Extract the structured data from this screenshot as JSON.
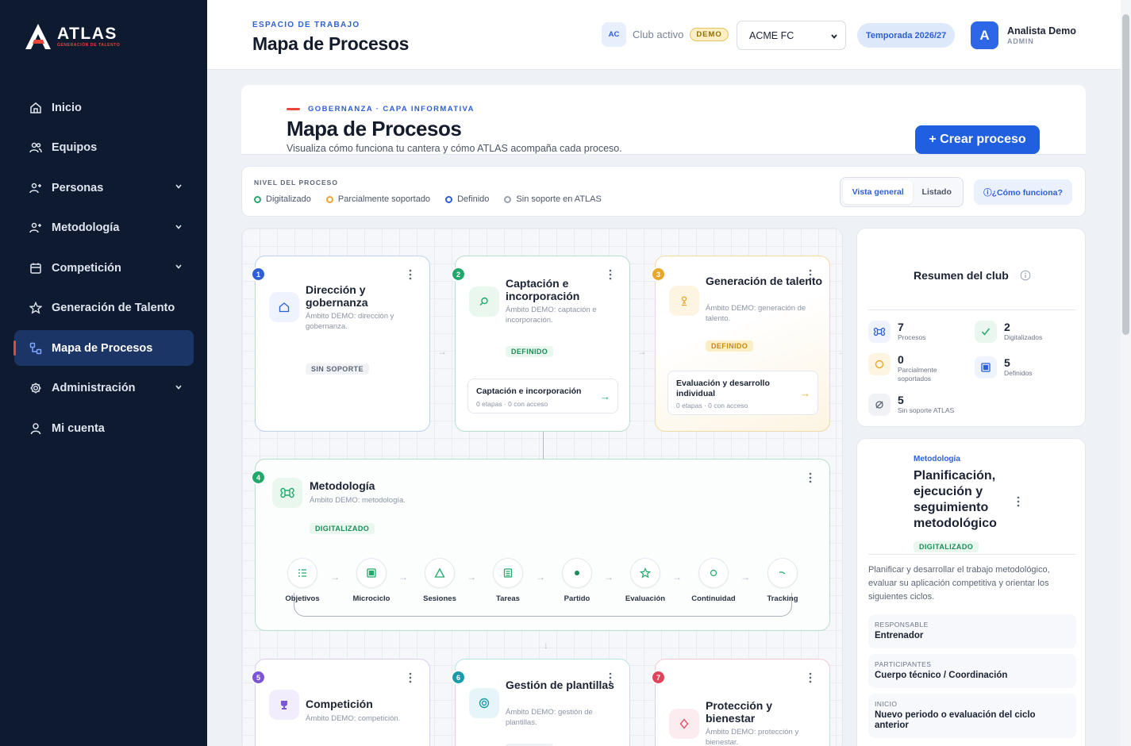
{
  "brand": {
    "name": "ATLAS",
    "tagline": "GENERACIÓN DE TALENTO"
  },
  "sidebar": {
    "items": [
      {
        "label": "Inicio",
        "icon": "home-icon"
      },
      {
        "label": "Equipos",
        "icon": "users-icon"
      },
      {
        "label": "Personas",
        "icon": "user-plus-icon",
        "expandable": true
      },
      {
        "label": "Metodología",
        "icon": "user-plus-icon",
        "expandable": true
      },
      {
        "label": "Competición",
        "icon": "calendar-icon",
        "expandable": true
      },
      {
        "label": "Generación de Talento",
        "icon": "star-icon"
      },
      {
        "label": "Mapa de Procesos",
        "icon": "process-map-icon",
        "active": true
      },
      {
        "label": "Administración",
        "icon": "gear-icon",
        "expandable": true
      },
      {
        "label": "Mi cuenta",
        "icon": "user-icon"
      }
    ]
  },
  "topbar": {
    "workspace_label": "ESPACIO DE TRABAJO",
    "title": "Mapa de Procesos",
    "club_badge": "AC",
    "club_label": "Club activo",
    "demo": "DEMO",
    "club_select": "ACME FC",
    "season": "Temporada 2026/27",
    "avatar": "A",
    "user_name": "Analista Demo",
    "user_role": "ADMIN"
  },
  "header": {
    "label": "GOBERNANZA · CAPA INFORMATIVA",
    "title": "Mapa de Procesos",
    "subtitle": "Visualiza cómo funciona tu cantera y cómo ATLAS acompaña cada proceso.",
    "create_button": "+ Crear proceso"
  },
  "filters": {
    "label": "NIVEL DEL PROCESO",
    "legend": [
      {
        "label": "Digitalizado",
        "color": "#21a86a"
      },
      {
        "label": "Parcialmente soportado",
        "color": "#e8a72c"
      },
      {
        "label": "Definido",
        "color": "#2d5fd6"
      },
      {
        "label": "Sin soporte en ATLAS",
        "color": "#9aa2b1"
      }
    ],
    "view_general": "Vista general",
    "view_list": "Listado",
    "how_button": "ⓘ¿Cómo funciona?"
  },
  "processes": [
    {
      "num": "1",
      "title": "Dirección y gobernanza",
      "desc": "Ámbito DEMO: dirección y gobernanza.",
      "status": "SIN SOPORTE",
      "icon": "home-icon"
    },
    {
      "num": "2",
      "title": "Captación e incorporación",
      "desc": "Ámbito DEMO: captación e incorporación.",
      "status": "DEFINIDO",
      "icon": "search-icon",
      "sub_title": "Captación e incorporación",
      "sub_meta": "0 etapas · 0 con acceso"
    },
    {
      "num": "3",
      "title": "Generación de talento",
      "desc": "Ámbito DEMO: generación de talento.",
      "status": "DEFINIDO",
      "icon": "trophy-icon",
      "sub_title": "Evaluación y desarrollo individual",
      "sub_meta": "0 etapas · 0 con acceso"
    },
    {
      "num": "4",
      "title": "Metodología",
      "desc": "Ámbito DEMO: metodología.",
      "status": "DIGITALIZADO",
      "icon": "command-icon"
    },
    {
      "num": "5",
      "title": "Competición",
      "desc": "Ámbito DEMO: competición.",
      "icon": "trophy-icon"
    },
    {
      "num": "6",
      "title": "Gestión de plantillas",
      "desc": "Ámbito DEMO: gestión de plantillas.",
      "icon": "target-icon"
    },
    {
      "num": "7",
      "title": "Protección y bienestar",
      "desc": "Ámbito DEMO: protección y bienestar.",
      "icon": "shield-icon"
    }
  ],
  "stages": [
    "Objetivos",
    "Microciclo",
    "Sesiones",
    "Tareas",
    "Partido",
    "Evaluación",
    "Continuidad",
    "Tracking"
  ],
  "summary": {
    "title": "Resumen del club",
    "stats": [
      {
        "value": "7",
        "label": "Procesos"
      },
      {
        "value": "2",
        "label": "Digitalizados"
      },
      {
        "value": "0",
        "label": "Parcialmente soportados"
      },
      {
        "value": "5",
        "label": "Definidos"
      },
      {
        "value": "5",
        "label": "Sin soporte ATLAS"
      }
    ]
  },
  "detail": {
    "label": "Metodología",
    "title": "Planificación, ejecución y seguimiento metodológico",
    "status": "DIGITALIZADO",
    "description": "Planificar y desarrollar el trabajo metodológico, evaluar su aplicación competitiva y orientar los siguientes ciclos.",
    "fields": [
      {
        "label": "RESPONSABLE",
        "value": "Entrenador"
      },
      {
        "label": "PARTICIPANTES",
        "value": "Cuerpo técnico / Coordinación"
      },
      {
        "label": "INICIO",
        "value": "Nuevo periodo o evaluación del ciclo anterior"
      }
    ]
  },
  "colors": {
    "accent": "#1f5fe0",
    "sidebar": "#0e1a30",
    "digital": "#21a86a",
    "partial": "#e8a72c",
    "defined": "#2d5fd6",
    "none": "#9aa2b1"
  }
}
